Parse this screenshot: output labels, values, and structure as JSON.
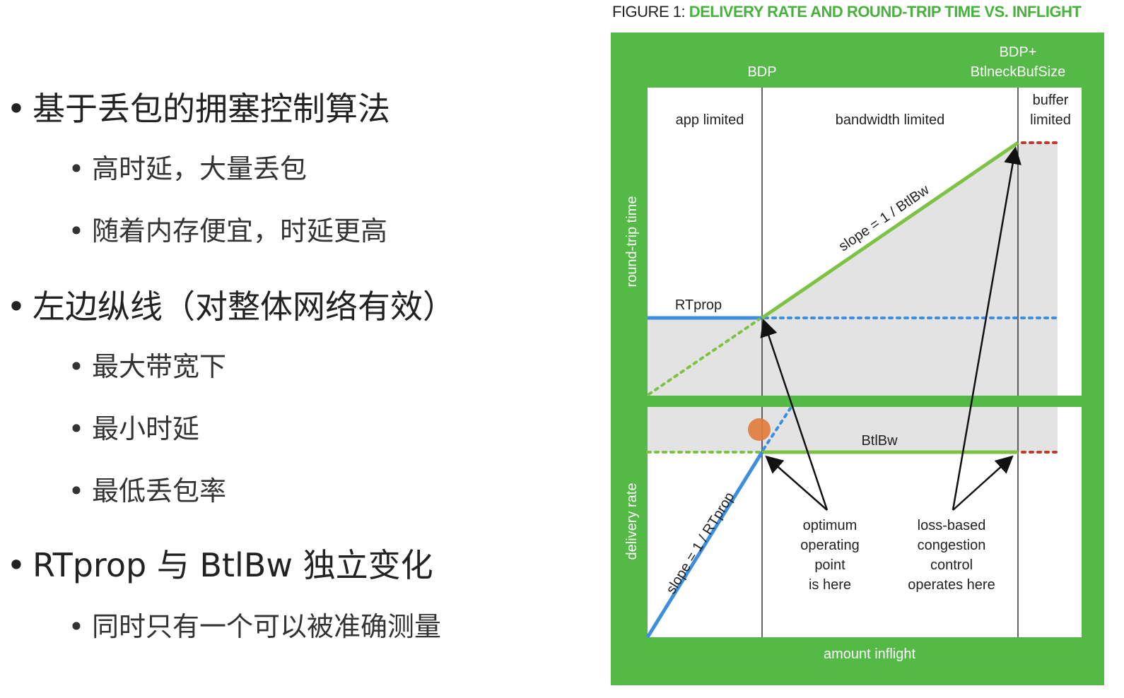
{
  "slide": {
    "bullets": [
      {
        "level": 1,
        "text": "基于丢包的拥塞控制算法"
      },
      {
        "level": 2,
        "text": "高时延，大量丢包"
      },
      {
        "level": 2,
        "text": "随着内存便宜，时延更高"
      },
      {
        "level": 1,
        "text": "左边纵线（对整体网络有效）"
      },
      {
        "level": 2,
        "text": "最大带宽下"
      },
      {
        "level": 2,
        "text": "最小时延"
      },
      {
        "level": 2,
        "text": "最低丢包率"
      },
      {
        "level": 1,
        "text": "RTprop 与 BtlBw 独立变化"
      },
      {
        "level": 2,
        "text": "同时只有一个可以被准确测量"
      }
    ],
    "bullet_glyph": "•"
  },
  "figure": {
    "caption_prefix": "FIGURE 1: ",
    "caption_title": "DELIVERY RATE AND ROUND-TRIP TIME VS. INFLIGHT",
    "bdp_label": "BDP",
    "bdp_buf_label_line1": "BDP+",
    "bdp_buf_label_line2": "BtlneckBufSize",
    "region_app": "app limited",
    "region_bandwidth": "bandwidth limited",
    "region_buffer_line1": "buffer",
    "region_buffer_line2": "limited",
    "rt_axis_label": "round-trip time",
    "rate_axis_label": "delivery rate",
    "x_axis_label": "amount inflight",
    "rtprop_label": "RTprop",
    "btlbw_label": "BtlBw",
    "slope_top": "slope = 1 / BtlBw",
    "slope_bottom": "slope = 1 / RTprop",
    "optimum_lines": [
      "optimum",
      "operating",
      "point",
      "is here"
    ],
    "lossbased_lines": [
      "loss-based",
      "congestion",
      "control",
      "operates here"
    ],
    "colors": {
      "background_green": "#55b947",
      "caption_green": "#47b23c",
      "line_green": "#7dc242",
      "line_blue": "#3b8ee0",
      "line_red": "#c0392b",
      "shade": "#e3e3e3",
      "cursor_orange": "#e07a3a"
    }
  }
}
